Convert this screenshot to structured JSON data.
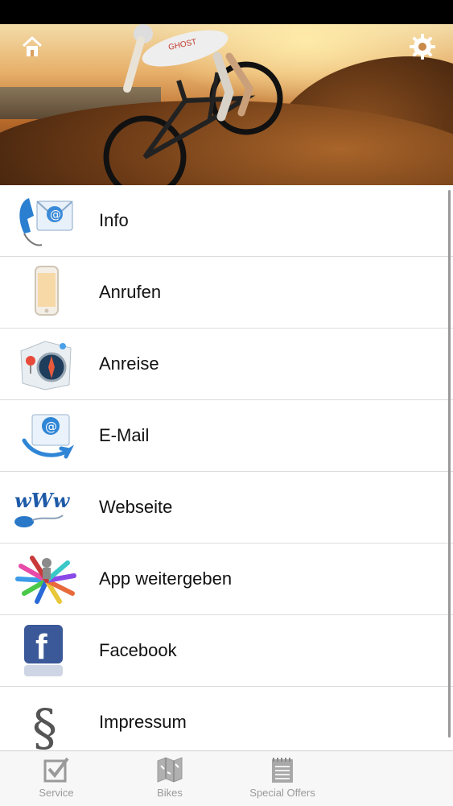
{
  "menu": {
    "items": [
      {
        "label": "Info",
        "icon": "phone-email-icon"
      },
      {
        "label": "Anrufen",
        "icon": "smartphone-icon"
      },
      {
        "label": "Anreise",
        "icon": "compass-map-icon"
      },
      {
        "label": "E-Mail",
        "icon": "email-at-icon"
      },
      {
        "label": "Webseite",
        "icon": "www-mouse-icon"
      },
      {
        "label": "App weitergeben",
        "icon": "share-arrows-icon"
      },
      {
        "label": "Facebook",
        "icon": "facebook-icon"
      },
      {
        "label": "Impressum",
        "icon": "paragraph-icon"
      }
    ]
  },
  "tabbar": {
    "tabs": [
      {
        "label": "Service",
        "icon": "checkbox-icon"
      },
      {
        "label": "Bikes",
        "icon": "map-icon"
      },
      {
        "label": "Special Offers",
        "icon": "notepad-icon"
      }
    ]
  },
  "colors": {
    "status_bar": "#000000",
    "separator": "#dcdcdc",
    "tab_inactive": "#9a9a9a",
    "facebook_blue": "#3b5998"
  }
}
